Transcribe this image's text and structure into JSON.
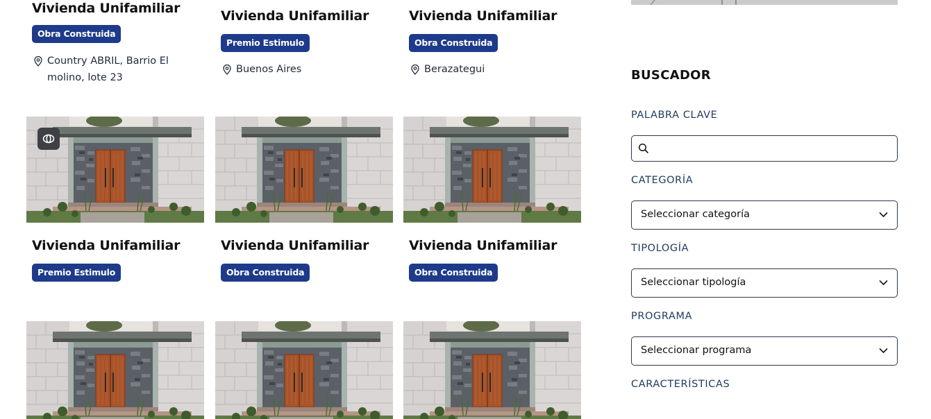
{
  "cards": [
    {
      "title": "Vivienda Unifamiliar",
      "badge": "Obra Construida",
      "location": "Country ABRIL, Barrio El molino, lote 23"
    },
    {
      "title": "Vivienda Unifamiliar",
      "badge": "Premio Estimulo",
      "location": "Buenos Aires"
    },
    {
      "title": "Vivienda Unifamiliar",
      "badge": "Obra Construida",
      "location": "Berazategui"
    },
    {
      "title": "Vivienda Unifamiliar",
      "badge": "Premio Estimulo"
    },
    {
      "title": "Vivienda Unifamiliar",
      "badge": "Obra Construida"
    },
    {
      "title": "Vivienda Unifamiliar",
      "badge": "Obra Construida"
    }
  ],
  "icons": {
    "location": "map-pin-icon",
    "panorama": "360-view-icon",
    "search": "search-icon",
    "dropdown": "chevron-down-icon"
  },
  "colors": {
    "badge": "#1e3a8a",
    "label": "#1e3a5f",
    "border": "#2d3748"
  },
  "sidebar": {
    "title": "BUSCADOR",
    "keyword_label": "PALABRA CLAVE",
    "keyword_value": "",
    "category_label": "CATEGORÍA",
    "category_value": "Seleccionar categoría",
    "typology_label": "TIPOLOGÍA",
    "typology_value": "Seleccionar tipología",
    "program_label": "PROGRAMA",
    "program_value": "Seleccionar programa",
    "features_label": "CARACTERÍSTICAS"
  }
}
